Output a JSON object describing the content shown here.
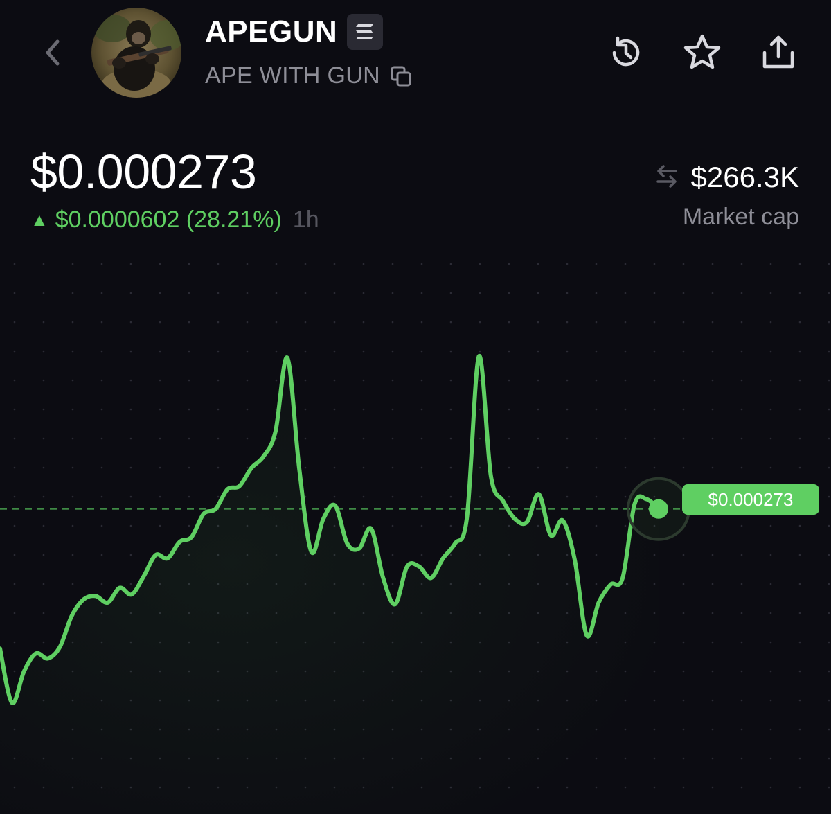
{
  "token": {
    "ticker": "APEGUN",
    "name": "APE WITH GUN",
    "chain_icon": "solana-icon"
  },
  "header": {
    "icons": [
      "chevron-left-icon",
      "history-icon",
      "star-icon",
      "share-icon",
      "copy-icon"
    ]
  },
  "price": {
    "current": "$0.000273",
    "change_arrow": "▲",
    "change_text": "$0.0000602 (28.21%)",
    "timeframe": "1h"
  },
  "market_cap": {
    "value": "$266.3K",
    "label": "Market cap",
    "icon": "swap-arrows-icon"
  },
  "colors": {
    "background": "#0c0c12",
    "accent_green": "#5fcf62",
    "muted_text": "#8e8e97"
  },
  "chart_data": {
    "type": "line",
    "title": "",
    "xlabel": "",
    "ylabel": "",
    "grid": "dotted",
    "current_price_label": "$0.000273",
    "reference_value": 0.000273,
    "ylim": [
      0.00014,
      0.000375
    ],
    "values": [
      0.000188,
      0.000155,
      0.000174,
      0.000185,
      0.000182,
      0.000189,
      0.000208,
      0.000218,
      0.00022,
      0.000216,
      0.000225,
      0.000221,
      0.000232,
      0.000245,
      0.000243,
      0.000253,
      0.000256,
      0.00027,
      0.000273,
      0.000285,
      0.000287,
      0.000298,
      0.000305,
      0.00032,
      0.000365,
      0.000297,
      0.000247,
      0.000267,
      0.000275,
      0.000252,
      0.000249,
      0.000261,
      0.000231,
      0.000215,
      0.000238,
      0.000238,
      0.000231,
      0.000243,
      0.000252,
      0.000268,
      0.000366,
      0.000293,
      0.000278,
      0.000267,
      0.000265,
      0.000282,
      0.000257,
      0.000266,
      0.000242,
      0.000196,
      0.000216,
      0.000227,
      0.000231,
      0.000276,
      0.000279,
      0.000273
    ]
  }
}
